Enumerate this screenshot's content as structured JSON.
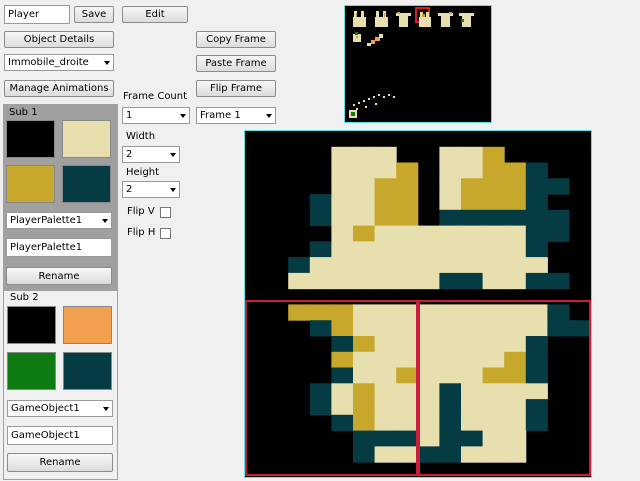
{
  "top": {
    "name_value": "Player",
    "save_label": "Save",
    "edit_label": "Edit",
    "object_details_label": "Object Details",
    "animation_select": "Immobile_droite",
    "manage_animations_label": "Manage Animations"
  },
  "frame_controls": {
    "copy_label": "Copy Frame",
    "paste_label": "Paste Frame",
    "flip_label": "Flip Frame",
    "frame_count_label": "Frame Count",
    "frame_count_value": "1",
    "frame_select": "Frame 1",
    "width_label": "Width",
    "width_value": "2",
    "height_label": "Height",
    "height_value": "2",
    "flipv_label": "Flip V",
    "fliph_label": "Flip H"
  },
  "sub1": {
    "title": "Sub 1",
    "colors": [
      "#000000",
      "#e8dfae",
      "#c8a82c",
      "#053c44"
    ],
    "palette_select": "PlayerPalette1",
    "name_value": "PlayerPalette1",
    "rename_label": "Rename"
  },
  "sub2": {
    "title": "Sub 2",
    "colors": [
      "#000000",
      "#f1a050",
      "#0e7a12",
      "#053c44"
    ],
    "palette_select": "GameObject1",
    "name_value": "GameObject1",
    "rename_label": "Rename"
  },
  "editor_palette": [
    "#000000",
    "#e8dfae",
    "#c8a82c",
    "#053c44"
  ],
  "editor_pixels": [
    "0000000000000000",
    "0000111001120000",
    "0000111201122300",
    "0000112201222330",
    "0003112201222300",
    "0003112203333330",
    "0000121111111330",
    "0003111111111300",
    "0031111111111100",
    "0011111113311330",
    "0000000000000000",
    "0022211111111130",
    "0003211111111133",
    "0000321111111300",
    "0000211111112300",
    "0000311211122300",
    "0003121113111100",
    "0003121113111300",
    "0000321113111300",
    "0000033313311000",
    "0000031133111000",
    "0000000000000000"
  ]
}
